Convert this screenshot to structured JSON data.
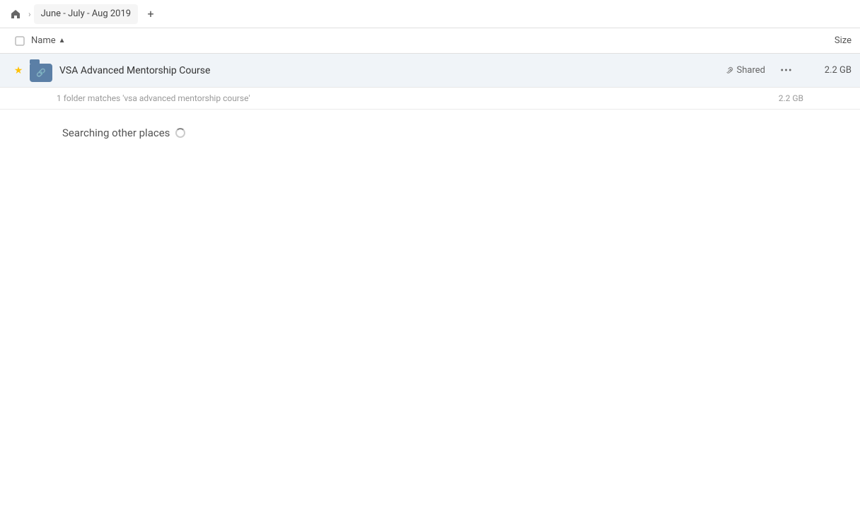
{
  "breadcrumb": {
    "home_icon": "🏠",
    "tab_label": "June - July - Aug 2019",
    "new_tab_icon": "+"
  },
  "column_headers": {
    "checkbox_label": "",
    "name_label": "Name",
    "sort_arrow": "▲",
    "size_label": "Size"
  },
  "file_row": {
    "star_icon": "★",
    "filename": "VSA Advanced Mentorship Course",
    "shared_label": "Shared",
    "more_icon": "···",
    "size": "2.2 GB"
  },
  "match_info": {
    "text": "1 folder matches 'vsa advanced mentorship course'",
    "size": "2.2 GB"
  },
  "searching": {
    "label": "Searching other places"
  },
  "colors": {
    "folder_blue": "#5b7fa6",
    "row_bg": "#f0f4f8",
    "star_yellow": "#ffc107",
    "shared_link_color": "#666"
  }
}
